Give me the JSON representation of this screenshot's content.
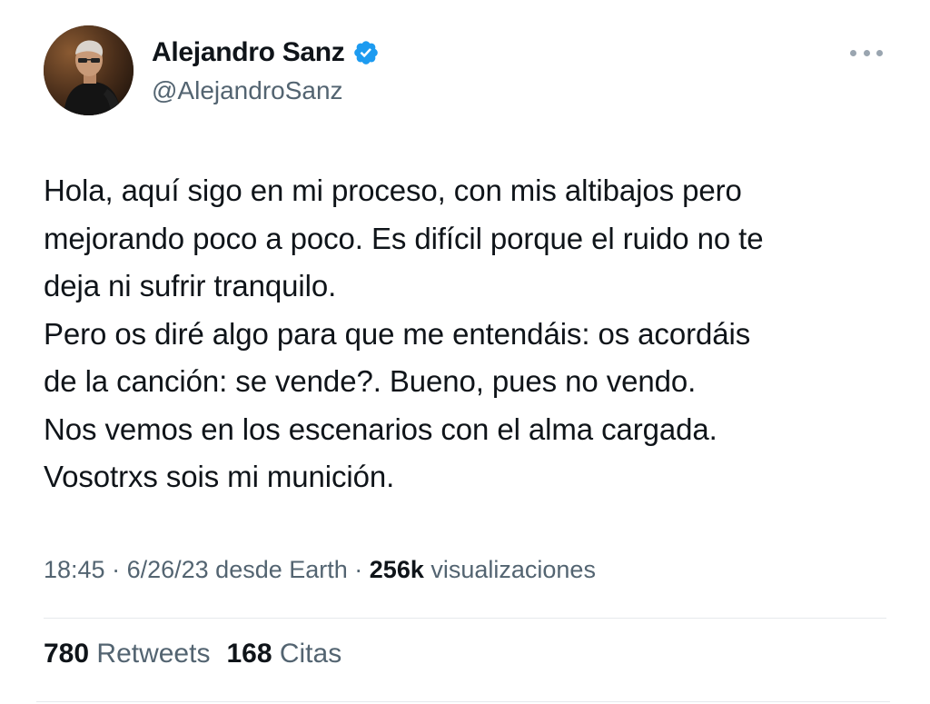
{
  "author": {
    "display_name": "Alejandro Sanz",
    "handle": "@AlejandroSanz",
    "verified_icon": "verified-badge-icon",
    "verified_color": "#1d9bf0"
  },
  "more_icon": "more-horizontal-icon",
  "tweet": {
    "lines": [
      "Hola, aquí sigo en mi proceso, con mis altibajos pero",
      "mejorando poco a poco. Es difícil porque el ruido no te",
      "deja ni sufrir tranquilo.",
      "Pero os diré algo para que me entendáis: os acordáis",
      "de la canción: se vende?. Bueno, pues no vendo.",
      "Nos vemos en los escenarios con el alma cargada.",
      "Vosotrxs sois mi munición."
    ]
  },
  "meta": {
    "time": "18:45",
    "separator1": " · ",
    "date": "6/26/23",
    "source": " desde Earth",
    "separator2": " · ",
    "views_count": "256k",
    "views_label": " visualizaciones"
  },
  "stats": {
    "retweets_count": "780",
    "retweets_label": " Retweets",
    "quotes_count": "168",
    "quotes_label": " Citas"
  },
  "colors": {
    "text_primary": "#0f1419",
    "text_secondary": "#536471",
    "divider": "#e6e9ec"
  }
}
